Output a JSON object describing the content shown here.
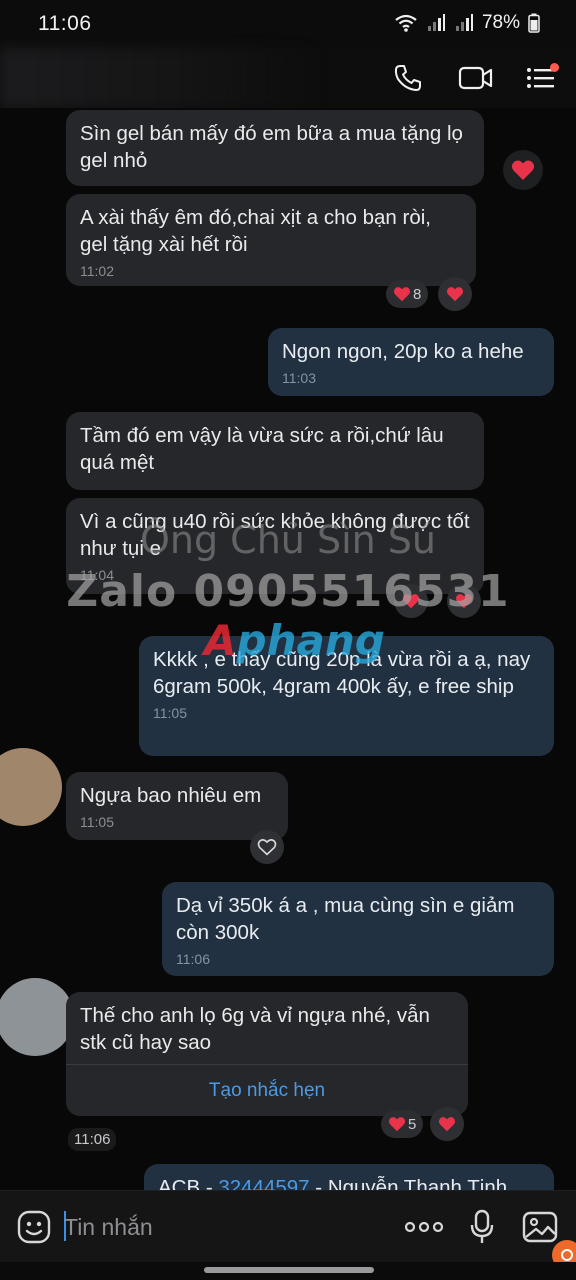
{
  "status_bar": {
    "time": "11:06",
    "battery": "78%"
  },
  "header": {
    "call_icon": "phone-icon",
    "video_icon": "video-camera-icon",
    "menu_icon": "list-menu-icon"
  },
  "messages": [
    {
      "id": "m1",
      "side": "in",
      "text": "Sìn gel bán mấy đó em bữa a mua tặng lọ gel nhỏ"
    },
    {
      "id": "m2",
      "side": "in",
      "text": "A xài thấy êm đó,chai xịt a cho bạn ròi, gel tặng xài hết rồi",
      "time": "11:02",
      "reaction_count": "8"
    },
    {
      "id": "m3",
      "side": "out",
      "text": "Ngon ngon, 20p ko a hehe",
      "time": "11:03"
    },
    {
      "id": "m4",
      "side": "in",
      "text": "Tầm đó em vậy là vừa sức a rồi,chứ lâu quá mệt"
    },
    {
      "id": "m5",
      "side": "in",
      "text": "Vì a cũng u40 rồi sức khỏe không được tốt như tụi e",
      "time": "11:04"
    },
    {
      "id": "m6",
      "side": "out",
      "text": "Kkkk , e thấy cũng 20p là vừa rồi a ạ, nay 6gram 500k, 4gram 400k ấy, e free ship",
      "time": "11:05"
    },
    {
      "id": "m7",
      "side": "in",
      "text": "Ngựa bao nhiêu em",
      "time": "11:05"
    },
    {
      "id": "m8",
      "side": "out",
      "text": "Dạ vỉ 350k á a , mua cùng sìn e giảm còn 300k",
      "time": "11:06"
    },
    {
      "id": "m9",
      "side": "in",
      "text": "Thế cho anh lọ 6g và vỉ ngựa nhé, vẫn stk cũ hay sao",
      "action": "Tạo nhắc hẹn",
      "reaction_count": "5"
    },
    {
      "id": "m10",
      "side": "out",
      "bank": "ACB",
      "account": "32444597",
      "name": "Nguyễn Thanh Tịnh"
    }
  ],
  "time_separator": "11:06",
  "watermark": {
    "line1": "Ông Chủ Sìn Sú",
    "line2": "Zalo 0905516531",
    "logo_part1": "A",
    "logo_part2": "phang"
  },
  "input_bar": {
    "placeholder": "Tin nhắn",
    "emoji_icon": "emoji-icon",
    "more_icon": "more-dots-icon",
    "mic_icon": "microphone-icon",
    "image_icon": "image-icon"
  },
  "colors": {
    "incoming_bubble": "#26272a",
    "outgoing_bubble": "#223142",
    "link": "#4b9ae6",
    "heart": "#e8334a"
  }
}
